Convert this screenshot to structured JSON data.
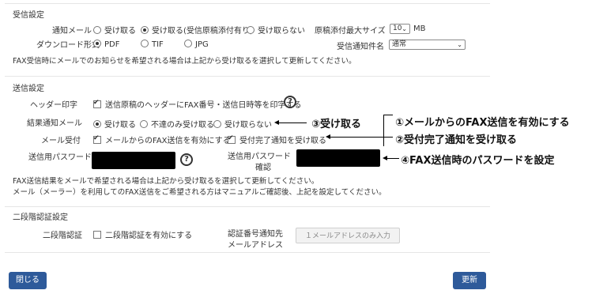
{
  "receive": {
    "title": "受信設定",
    "notify_mail_label": "通知メール",
    "notify_options": [
      "受け取る",
      "受け取る(受信原稿添付有り)",
      "受け取らない"
    ],
    "notify_selected": 1,
    "max_size_label": "原稿添付最大サイズ",
    "max_size_value": "10",
    "max_size_unit": "MB",
    "download_label": "ダウンロード形式",
    "download_options": [
      "PDF",
      "TIF",
      "JPG"
    ],
    "download_selected": 0,
    "subject_label": "受信通知件名",
    "subject_value": "通常",
    "note": "FAX受信時にメールでのお知らせを希望される場合は上記から受け取るを選択して更新してください。"
  },
  "send": {
    "title": "送信設定",
    "header_label": "ヘッダー印字",
    "header_check": "送信原稿のヘッダーにFAX番号・送信日時等を印字する",
    "result_label": "結果通知メール",
    "result_options": [
      "受け取る",
      "不達のみ受け取る",
      "受け取らない"
    ],
    "result_selected": 0,
    "mail_accept_label": "メール受付",
    "mail_accept_check": "メールからのFAX送信を有効にする",
    "complete_check": "受付完了通知を受け取る",
    "password_label": "送信用パスワード",
    "password_confirm_label_1": "送信用パスワード",
    "password_confirm_label_2": "確認",
    "note_1": "FAX送信結果をメールで希望される場合は上記から受け取るを選択して更新してください。",
    "note_2": "メール（メーラー）を利用してのFAX送信をご希望される方はマニュアルご確認後、上記を設定してください。"
  },
  "twofactor": {
    "title": "二段階認証設定",
    "label": "二段階認証",
    "check": "二段階認証を有効にする",
    "dest_label_1": "認証番号通知先",
    "dest_label_2": "メールアドレス",
    "dest_placeholder": "１メールアドレスのみ入力"
  },
  "annotations": {
    "a1": "①メールからのFAX送信を有効にする",
    "a2": "②受付完了通知を受け取る",
    "a3": "③受け取る",
    "a4": "④FAX送信時のパスワードを設定"
  },
  "buttons": {
    "close": "閉じる",
    "update": "更新"
  },
  "icons": {
    "help": "question-circle-icon"
  }
}
